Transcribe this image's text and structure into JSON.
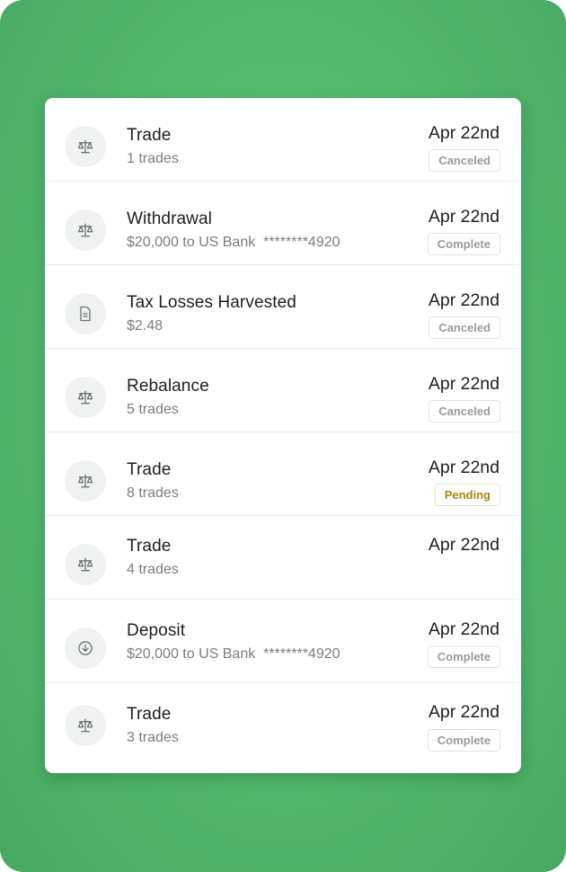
{
  "colors": {
    "background": "#52b86d",
    "card": "#ffffff",
    "pending": "#a8860c",
    "muted": "#9a9a9a"
  },
  "transactions": [
    {
      "icon": "scale-icon",
      "title": "Trade",
      "subtitle": "1 trades",
      "date": "Apr 22nd",
      "status": "Canceled"
    },
    {
      "icon": "scale-icon",
      "title": "Withdrawal",
      "subtitle": "$20,000 to US Bank  ********4920",
      "date": "Apr 22nd",
      "status": "Complete"
    },
    {
      "icon": "document-icon",
      "title": "Tax Losses Harvested",
      "subtitle": "$2.48",
      "date": "Apr 22nd",
      "status": "Canceled"
    },
    {
      "icon": "scale-icon",
      "title": "Rebalance",
      "subtitle": "5 trades",
      "date": "Apr 22nd",
      "status": "Canceled"
    },
    {
      "icon": "scale-icon",
      "title": "Trade",
      "subtitle": "8 trades",
      "date": "Apr 22nd",
      "status": "Pending"
    },
    {
      "icon": "scale-icon",
      "title": "Trade",
      "subtitle": "4 trades",
      "date": "Apr 22nd",
      "status": ""
    },
    {
      "icon": "arrow-down-circle-icon",
      "title": "Deposit",
      "subtitle": "$20,000 to US Bank  ********4920",
      "date": "Apr 22nd",
      "status": "Complete"
    },
    {
      "icon": "scale-icon",
      "title": "Trade",
      "subtitle": "3 trades",
      "date": "Apr 22nd",
      "status": "Complete"
    }
  ]
}
